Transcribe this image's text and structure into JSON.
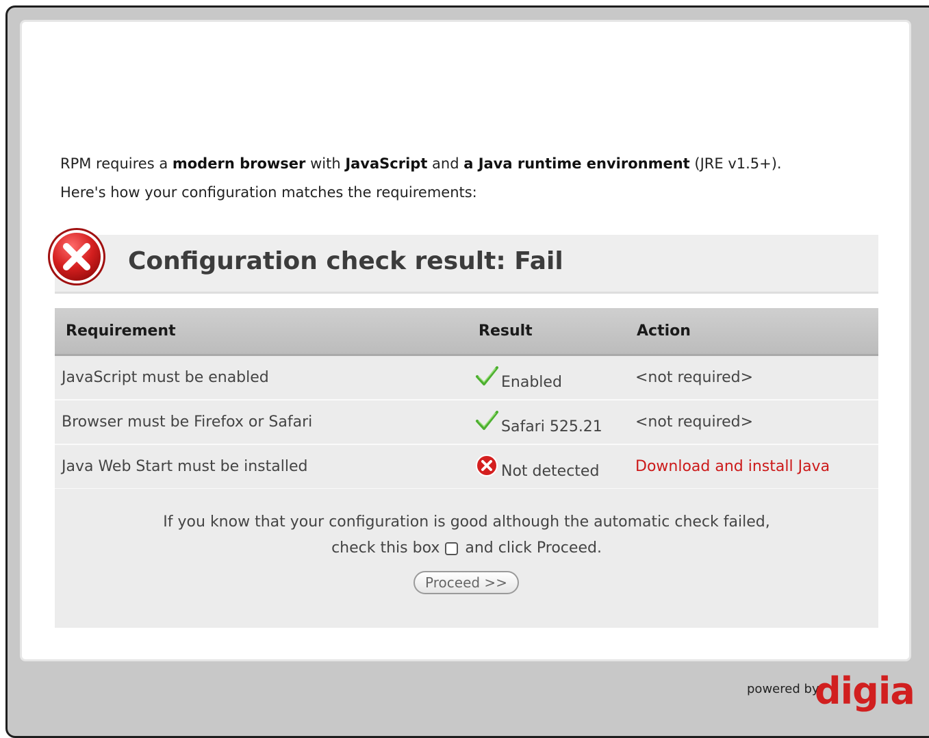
{
  "intro": {
    "line1_part1": "RPM requires a ",
    "line1_bold1": "modern browser",
    "line1_part2": " with ",
    "line1_bold2": "JavaScript",
    "line1_part3": " and ",
    "line1_bold3": "a Java runtime environment",
    "line1_part4": " (JRE v1.5+).",
    "line2": "Here's how your configuration matches the requirements:"
  },
  "result": {
    "title": "Configuration check result: Fail",
    "icon": "fail-x-icon",
    "color": "#d41f1f"
  },
  "table": {
    "headers": {
      "requirement": "Requirement",
      "result": "Result",
      "action": "Action"
    },
    "rows": [
      {
        "requirement": "JavaScript must be enabled",
        "result_icon": "check-icon",
        "result": "Enabled",
        "action": "<not required>"
      },
      {
        "requirement": "Browser must be Firefox or Safari",
        "result_icon": "check-icon",
        "result": "Safari 525.21",
        "action": "<not required>"
      },
      {
        "requirement": "Java Web Start must be installed",
        "result_icon": "fail-x-icon",
        "result": "Not detected",
        "action": "Download and install Java"
      }
    ]
  },
  "override": {
    "line1": "If you know that your configuration is good although the automatic check failed,",
    "line2_before": "check this box",
    "line2_after": "and click Proceed.",
    "checkbox_checked": false,
    "proceed_label": "Proceed >>"
  },
  "footer": {
    "powered_by": "powered by",
    "brand": "digia",
    "brand_color": "#d11f1f"
  },
  "colors": {
    "check_green": "#4caf2f",
    "link_red": "#cc1a1a"
  }
}
